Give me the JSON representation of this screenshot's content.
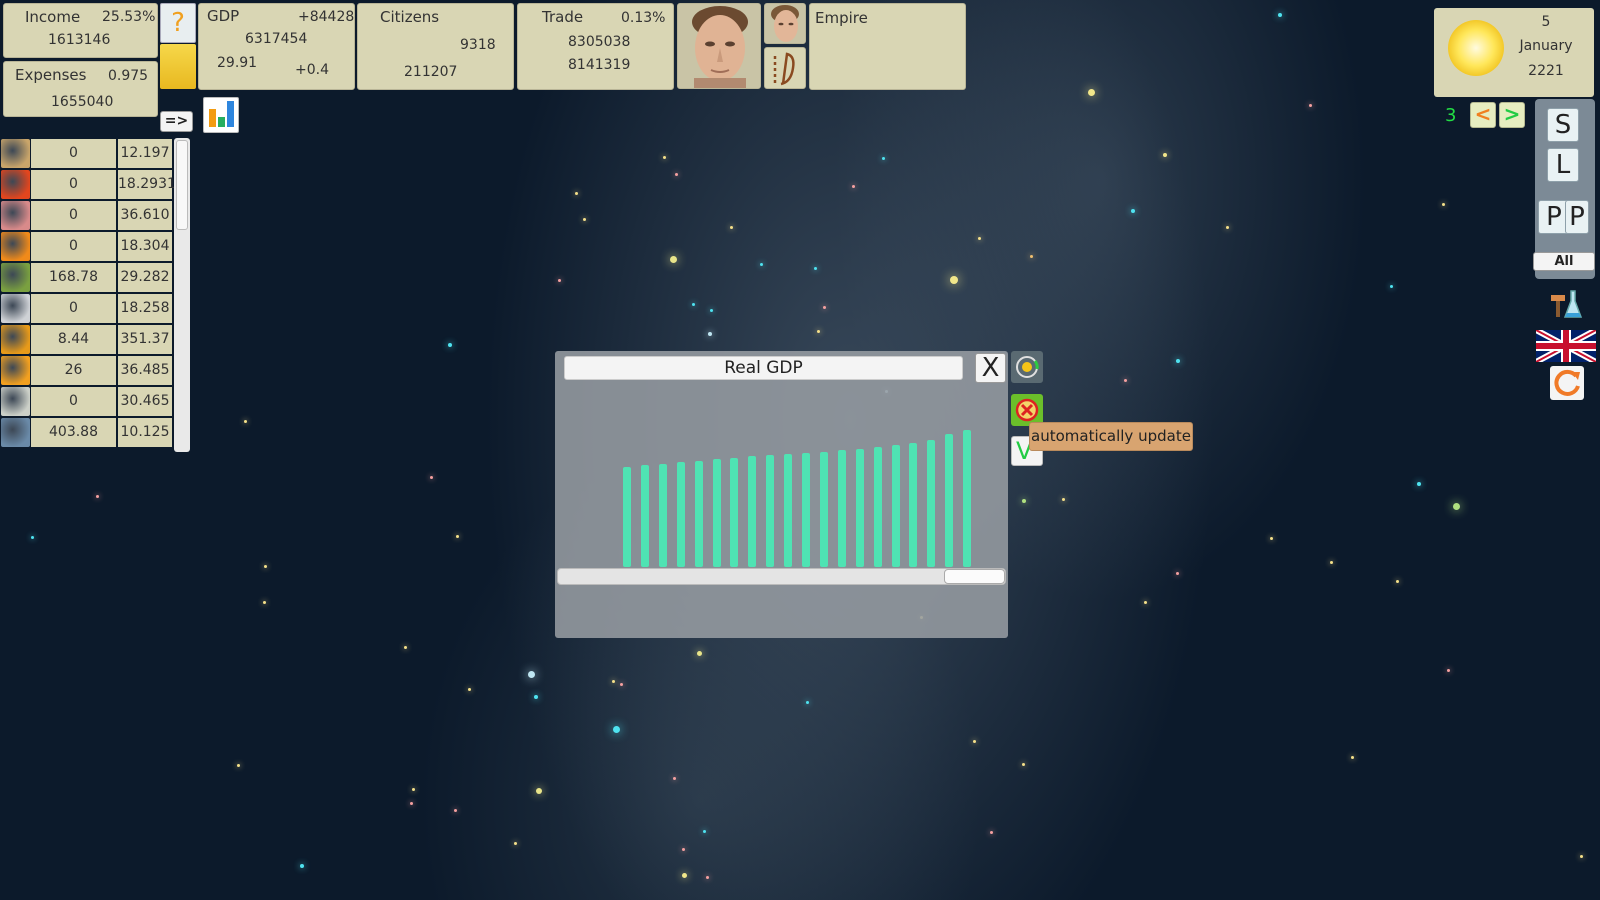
{
  "income": {
    "label": "Income",
    "percent": "25.53%",
    "value": "1613146"
  },
  "expenses": {
    "label": "Expenses",
    "ratio": "0.975",
    "value": "1655040"
  },
  "help": {
    "label": "?"
  },
  "gdp": {
    "label": "GDP",
    "change": "+84428",
    "value": "6317454",
    "per_capita": "29.91",
    "per_capita_change": "+0.4"
  },
  "citizens": {
    "label": "Citizens",
    "count": "9318",
    "total": "211207"
  },
  "trade": {
    "label": "Trade",
    "percent": "0.13%",
    "exports": "8305038",
    "imports": "8141319"
  },
  "empire": {
    "label": "Empire"
  },
  "toolbar": {
    "arrow_label": "=>"
  },
  "resources": [
    {
      "icon": "wheat-icon",
      "amount": "0",
      "price": "12.197"
    },
    {
      "icon": "tomato-icon",
      "amount": "0",
      "price": "18.2931"
    },
    {
      "icon": "meat-icon",
      "amount": "0",
      "price": "36.610"
    },
    {
      "icon": "orange-icon",
      "amount": "0",
      "price": "18.304"
    },
    {
      "icon": "fruit-icon",
      "amount": "168.78",
      "price": "29.282"
    },
    {
      "icon": "cotton-icon",
      "amount": "0",
      "price": "18.258"
    },
    {
      "icon": "honey-icon",
      "amount": "8.44",
      "price": "351.37"
    },
    {
      "icon": "shirt-icon",
      "amount": "26",
      "price": "36.485"
    },
    {
      "icon": "bottle-icon",
      "amount": "0",
      "price": "30.465"
    },
    {
      "icon": "ore-icon",
      "amount": "403.88",
      "price": "10.125"
    }
  ],
  "graph_window": {
    "title": "Real GDP",
    "close_label": "X",
    "tooltip": "automatically update",
    "confirm_label": "V",
    "chart_data": {
      "type": "bar",
      "title": "Real GDP",
      "ylim": [
        0,
        100
      ],
      "values": [
        68,
        69,
        70,
        71,
        72,
        73,
        74,
        75,
        76,
        76.5,
        77,
        78,
        79,
        80,
        81,
        83,
        84,
        86,
        90,
        93
      ]
    }
  },
  "date": {
    "day": "5",
    "month": "January",
    "year": "2221"
  },
  "speed": {
    "value": "3",
    "slower_label": "<",
    "faster_label": ">"
  },
  "utility": {
    "save_label": "S",
    "load_label": "L",
    "pause_label_1": "P",
    "pause_label_2": "P",
    "all_label": "All"
  },
  "colors": {
    "panel": "#d9d6b4",
    "bar": "#4fe3b3",
    "tooltip": "#d8a470",
    "speed_green": "#22dd44"
  }
}
